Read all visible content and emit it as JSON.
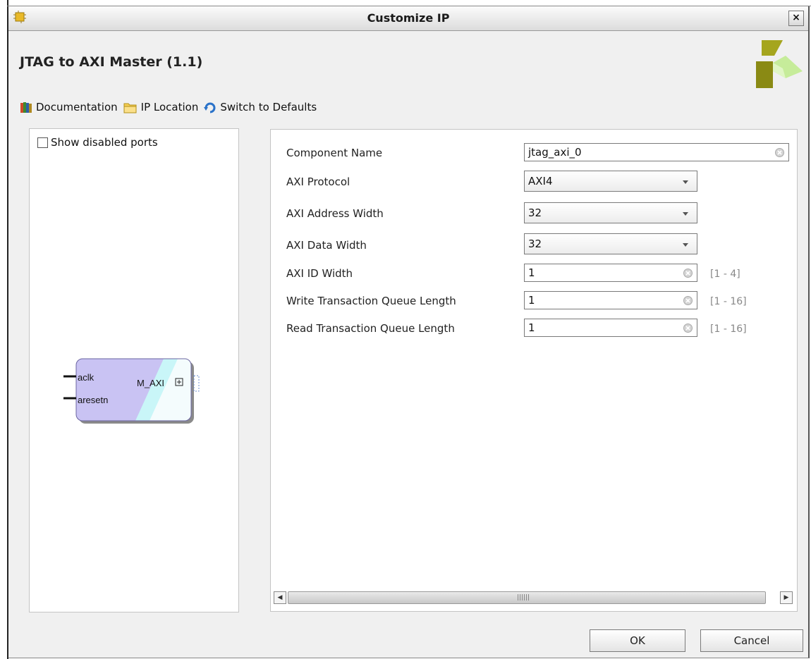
{
  "window": {
    "title": "Customize IP",
    "close_label": "×"
  },
  "ip": {
    "title": "JTAG to AXI Master (1.1)"
  },
  "toolbar": [
    {
      "label": "Documentation",
      "icon": "documentation-icon"
    },
    {
      "label": "IP Location",
      "icon": "folder-icon"
    },
    {
      "label": "Switch to Defaults",
      "icon": "refresh-icon"
    }
  ],
  "symbol_panel": {
    "show_disabled_label": "Show disabled ports",
    "show_disabled_checked": false,
    "ports": {
      "clk": "aclk",
      "reset": "aresetn",
      "master": "M_AXI"
    }
  },
  "params": {
    "component_name": {
      "label": "Component Name",
      "value": "jtag_axi_0"
    },
    "protocol": {
      "label": "AXI Protocol",
      "value": "AXI4"
    },
    "address_width": {
      "label": "AXI Address Width",
      "value": "32"
    },
    "data_width": {
      "label": "AXI Data Width",
      "value": "32"
    },
    "id_width": {
      "label": "AXI ID Width",
      "value": "1",
      "range": "[1 - 4]"
    },
    "write_queue": {
      "label": "Write Transaction Queue Length",
      "value": "1",
      "range": "[1 - 16]"
    },
    "read_queue": {
      "label": "Read Transaction Queue Length",
      "value": "1",
      "range": "[1 - 16]"
    }
  },
  "buttons": {
    "ok": "OK",
    "cancel": "Cancel"
  },
  "colors": {
    "symbol_fill": "#c9c3f3",
    "symbol_accent": "#c9f6f8",
    "logo_dark": "#8a8a14",
    "logo_light": "#c6ec9a"
  }
}
